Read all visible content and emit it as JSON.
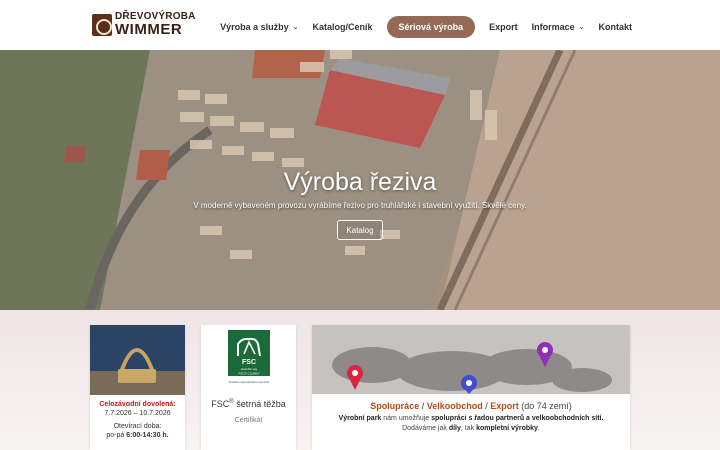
{
  "header": {
    "logo": {
      "line1": "DŘEVOVÝROBA",
      "line2": "WIMMER"
    },
    "nav": [
      {
        "label": "Výroba a služby",
        "dropdown": true
      },
      {
        "label": "Katalog/Ceník",
        "dropdown": false
      },
      {
        "label": "Sériová výroba",
        "cta": true
      },
      {
        "label": "Export",
        "dropdown": false
      },
      {
        "label": "Informace",
        "dropdown": true
      },
      {
        "label": "Kontakt",
        "dropdown": false
      }
    ]
  },
  "hero": {
    "title": "Výroba řeziva",
    "subtitle": "V moderně vybaveném provozu vyrábíme řezivo pro truhlářské i stavební využití. Skvělé ceny.",
    "button": "Katalog"
  },
  "cards": {
    "holiday": {
      "title": "Celozávodní dovolená:",
      "dates": "7.7.2026 – 10.7.2026",
      "hours_label": "Otevírací doba:",
      "hours_days": "po-pá",
      "hours_time": "6:00-14:30 h."
    },
    "fsc": {
      "logo_text": "FSC",
      "logo_url": "www.fsc.org",
      "logo_code": "FSC® C118307",
      "logo_caption": "Značka odpovědného lesnictví",
      "title": "FSC",
      "title_sup": "®",
      "title_rest": " šetrná těžba",
      "subtitle": "Certifikát"
    },
    "coop": {
      "title_part1": "Spolupráce",
      "title_part2": "Velkoobchod",
      "title_part3": "Export",
      "title_light": "(do 74 zemí)",
      "desc_line1_a": "Výrobní park",
      "desc_line1_b": " nám umožňuje ",
      "desc_line1_c": "spolupráci s řadou partnerů a velkoobchodních sítí.",
      "desc_line2_a": "Dodáváme jak ",
      "desc_line2_b": "díly",
      "desc_line2_c": ", tak ",
      "desc_line2_d": "kompletní výrobky",
      "desc_line2_e": "."
    }
  },
  "colors": {
    "brand_brown": "#946a55",
    "holiday_red": "#c01818",
    "coop_orange": "#b04c1c",
    "fsc_green": "#1b6b3a",
    "pin_red": "#d7263d",
    "pin_purple": "#8e2fb5",
    "pin_blue": "#3f4fd0"
  }
}
